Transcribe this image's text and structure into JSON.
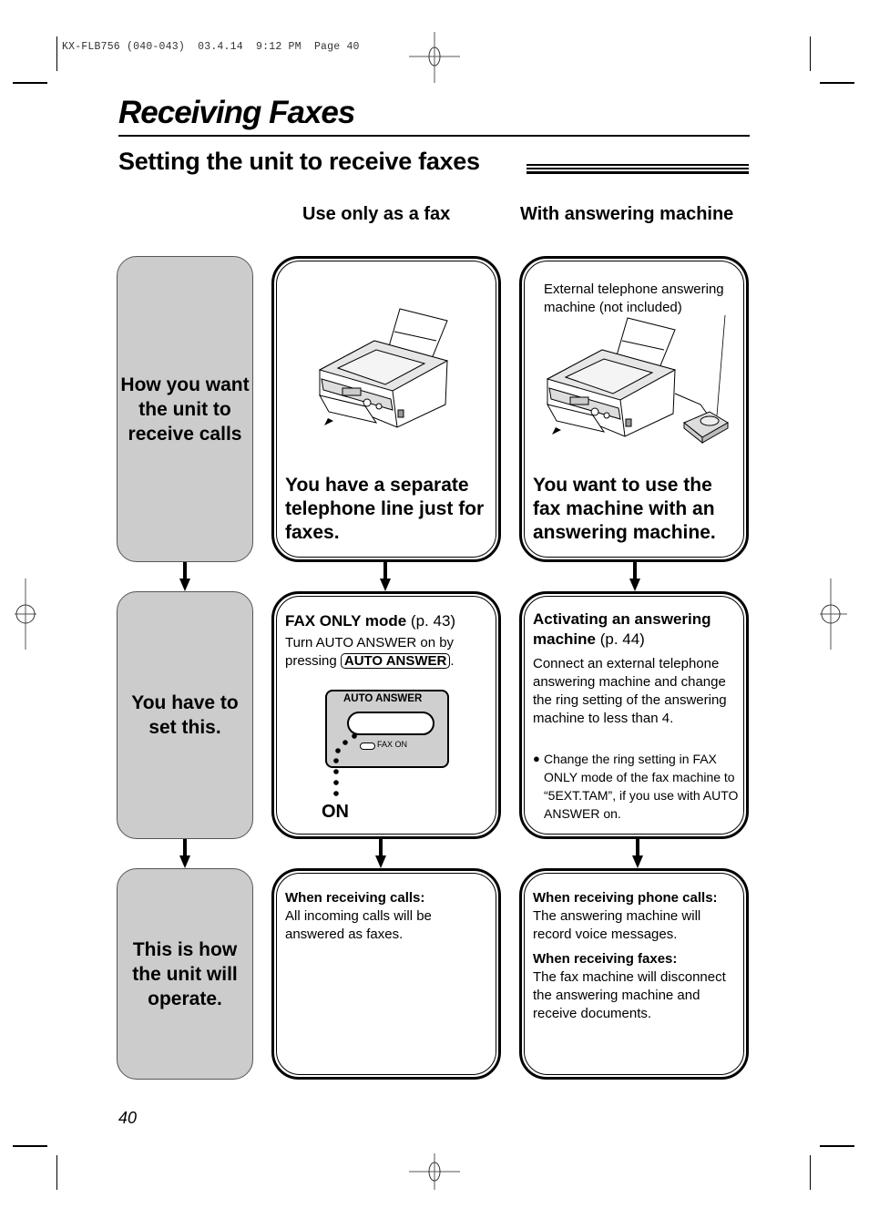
{
  "print_header": "KX-FLB756 (040-043)  03.4.14  9:12 PM  Page 40",
  "page_title": "Receiving Faxes",
  "section_title": "Setting the unit to receive faxes",
  "columns": {
    "fax_only": "Use only as a fax",
    "with_tam": "With answering machine"
  },
  "rows": [
    {
      "label": "How you want the unit to receive calls"
    },
    {
      "label": "You have to set this."
    },
    {
      "label": "This is how the unit will operate."
    }
  ],
  "fax_only": {
    "scenario": "You have a separate telephone line just for faxes.",
    "setting": {
      "heading_bold": "FAX ONLY mode",
      "heading_ref": " (p. 43)",
      "text_before": "Turn AUTO ANSWER on by pressing ",
      "key": "AUTO ANSWER",
      "text_after": ".",
      "panel_label": "AUTO ANSWER",
      "indicator_label": "FAX ON",
      "state_label": "ON"
    },
    "operation": {
      "heading": "When receiving calls:",
      "text": "All incoming calls will be answered as faxes."
    }
  },
  "with_tam": {
    "callout": "External telephone answering machine (not included)",
    "scenario": "You want to use the fax machine with an answering machine.",
    "setting": {
      "heading_bold": "Activating an answering machine",
      "heading_ref": " (p. 44)",
      "text": "Connect an external telephone answering machine and change the ring setting of the answering machine to less than 4.",
      "bullet": "Change the ring setting in FAX ONLY mode of the fax machine to “5EXT.TAM”, if you use with AUTO ANSWER on."
    },
    "operation": {
      "phone_heading": "When receiving phone calls:",
      "phone_text": "The answering machine will record voice messages.",
      "fax_heading": "When receiving faxes:",
      "fax_text": "The fax machine will disconnect the answering machine and receive documents."
    }
  },
  "page_number": "40"
}
